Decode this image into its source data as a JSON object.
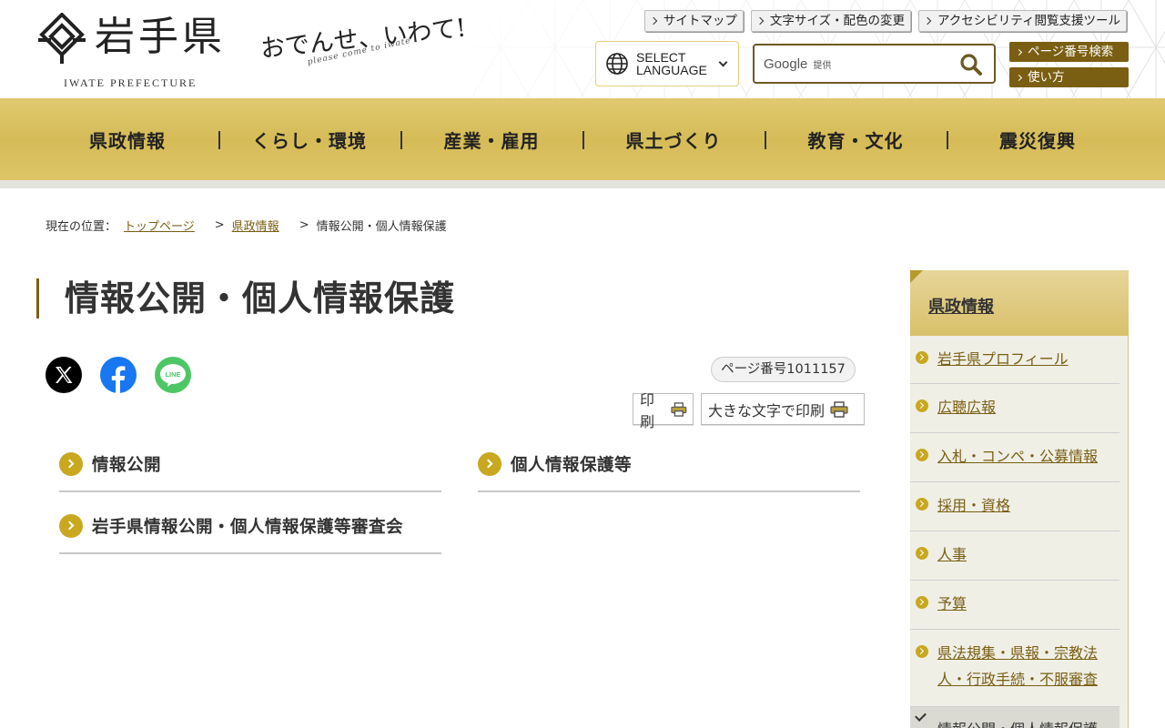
{
  "header": {
    "logo_title": "岩手県",
    "logo_sub": "IWATE PREFECTURE",
    "tagline": "おでんせ、いわて!",
    "tagline_sub": "please come to iwate",
    "top_links": [
      "サイトマップ",
      "文字サイズ・配色の変更",
      "アクセシビリティ閲覧支援ツール"
    ],
    "language_line1": "SELECT",
    "language_line2": "LANGUAGE",
    "search_provider": "Google",
    "search_provider_suffix": "提供",
    "side_buttons": [
      "ページ番号検索",
      "使い方"
    ]
  },
  "gnav": [
    "県政情報",
    "くらし・環境",
    "産業・雇用",
    "県土づくり",
    "教育・文化",
    "震災復興"
  ],
  "breadcrumb": {
    "label": "現在の位置：",
    "items": [
      "トップページ",
      "県政情報"
    ],
    "current": "情報公開・個人情報保護"
  },
  "main": {
    "title": "情報公開・個人情報保護",
    "page_number": "ページ番号1011157",
    "print_label": "印刷",
    "print_large_label": "大きな文字で印刷",
    "sns": [
      "x-icon",
      "facebook-icon",
      "line-icon"
    ],
    "line_text": "LINE",
    "links": [
      "情報公開",
      "個人情報保護等",
      "岩手県情報公開・個人情報保護等審査会"
    ]
  },
  "sidebar": {
    "heading": "県政情報",
    "items": [
      {
        "line1": "岩手県プロフィール"
      },
      {
        "line1": "広聴広報"
      },
      {
        "line1": "入札・コンペ・公募情報"
      },
      {
        "line1": "採用・資格"
      },
      {
        "line1": "人事"
      },
      {
        "line1": "予算"
      },
      {
        "line1": "県法規集・県報・宗教法",
        "line2": "人・行政手続・不服審査"
      },
      {
        "line1": "情報公開・個人情報保護"
      }
    ]
  },
  "colors": {
    "gold": "#d6bc57",
    "brown": "#7a5e12",
    "bullet": "#c9a820"
  }
}
